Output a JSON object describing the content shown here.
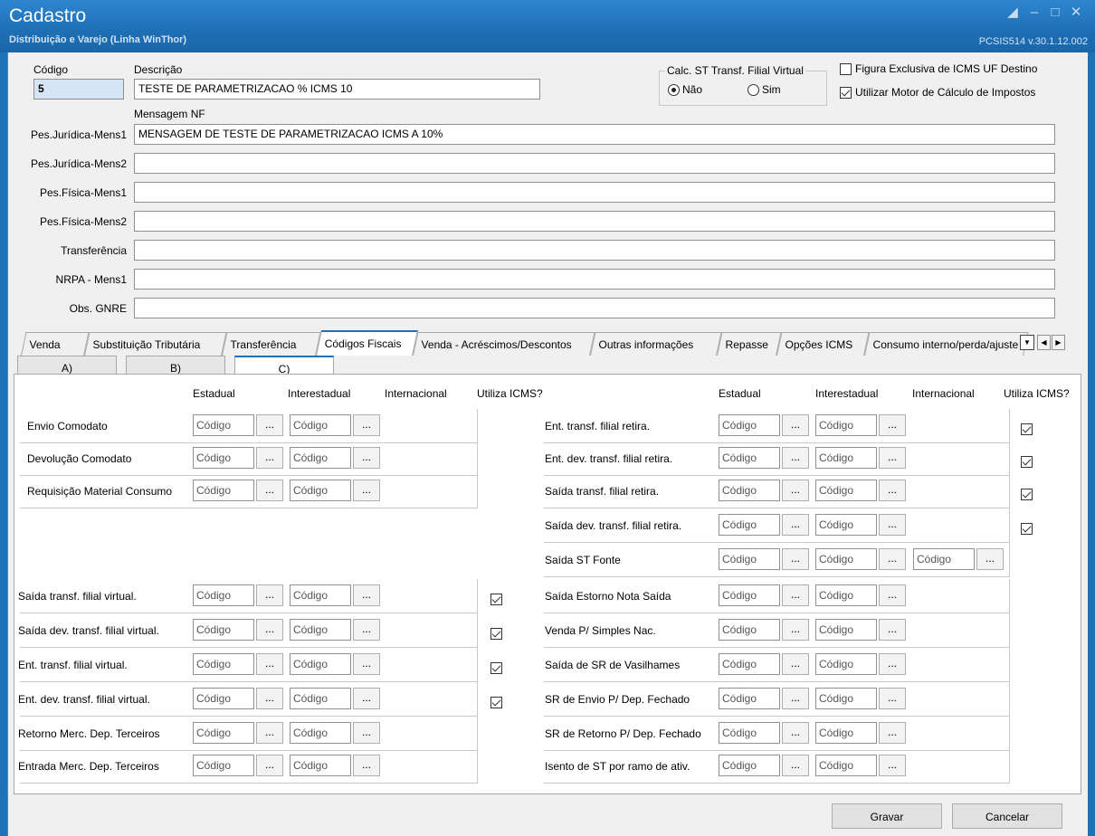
{
  "window": {
    "title": "Cadastro",
    "subtitle": "Distribuição e Varejo (Linha WinThor)",
    "version": "PCSIS514  v.30.1.12.002"
  },
  "header": {
    "codigo_label": "Código",
    "codigo_value": "5",
    "descricao_label": "Descrição",
    "descricao_value": "TESTE DE PARAMETRIZACAO % ICMS 10",
    "calc_st_label": "Calc. ST Transf. Filial Virtual",
    "radio_nao": "Não",
    "radio_sim": "Sim",
    "figura_label": "Figura Exclusiva de ICMS UF Destino",
    "motor_label": "Utilizar Motor de Cálculo de Impostos",
    "mensagem_nf_label": "Mensagem NF"
  },
  "messages": [
    {
      "label": "Pes.Jurídica-Mens1",
      "value": "MENSAGEM DE TESTE DE PARAMETRIZACAO ICMS A 10%"
    },
    {
      "label": "Pes.Jurídica-Mens2",
      "value": ""
    },
    {
      "label": "Pes.Física-Mens1",
      "value": ""
    },
    {
      "label": "Pes.Física-Mens2",
      "value": ""
    },
    {
      "label": "Transferência",
      "value": ""
    },
    {
      "label": "NRPA - Mens1",
      "value": ""
    },
    {
      "label": "Obs. GNRE",
      "value": ""
    }
  ],
  "tabs": [
    "Venda",
    "Substituição Tributária",
    "Transferência",
    "Códigos Fiscais",
    "Venda - Acréscimos/Descontos",
    "Outras informações",
    "Repasse",
    "Opções ICMS",
    "Consumo interno/perda/ajuste"
  ],
  "subtabs": [
    "A)",
    "B)",
    "C)"
  ],
  "columns": {
    "estadual": "Estadual",
    "interestadual": "Interestadual",
    "internacional": "Internacional",
    "utiliza": "Utiliza ICMS?"
  },
  "placeholder": "Código",
  "dots": "...",
  "left_top_rows": [
    {
      "label": "Envio Comodato"
    },
    {
      "label": "Devolução Comodato"
    },
    {
      "label": "Requisição Material Consumo"
    }
  ],
  "left_bottom_rows": [
    {
      "label": "Saída transf. filial virtual.",
      "checked": true
    },
    {
      "label": "Saída dev. transf. filial virtual.",
      "checked": true
    },
    {
      "label": "Ent. transf. filial virtual.",
      "checked": true
    },
    {
      "label": "Ent. dev. transf. filial virtual.",
      "checked": true
    },
    {
      "label": "Retorno Merc. Dep. Terceiros",
      "checked": false
    },
    {
      "label": "Entrada Merc. Dep. Terceiros",
      "checked": false
    }
  ],
  "right_rows": [
    {
      "label": "Ent. transf. filial retira.",
      "checked": true
    },
    {
      "label": "Ent. dev. transf. filial retira.",
      "checked": true
    },
    {
      "label": "Saída transf. filial retira.",
      "checked": true
    },
    {
      "label": "Saída dev. transf. filial retira.",
      "checked": true
    },
    {
      "label": "Saída ST Fonte",
      "checked": false
    },
    {
      "label": "Saída Estorno Nota Saída",
      "checked": false
    },
    {
      "label": "Venda P/ Simples Nac.",
      "checked": false
    },
    {
      "label": "Saída de SR de Vasilhames",
      "checked": false
    },
    {
      "label": "SR de Envio P/ Dep. Fechado",
      "checked": false
    },
    {
      "label": "SR de Retorno P/ Dep. Fechado",
      "checked": false
    },
    {
      "label": "Isento de ST por ramo de ativ.",
      "checked": false
    }
  ],
  "footer": {
    "gravar": "Gravar",
    "cancelar": "Cancelar"
  }
}
